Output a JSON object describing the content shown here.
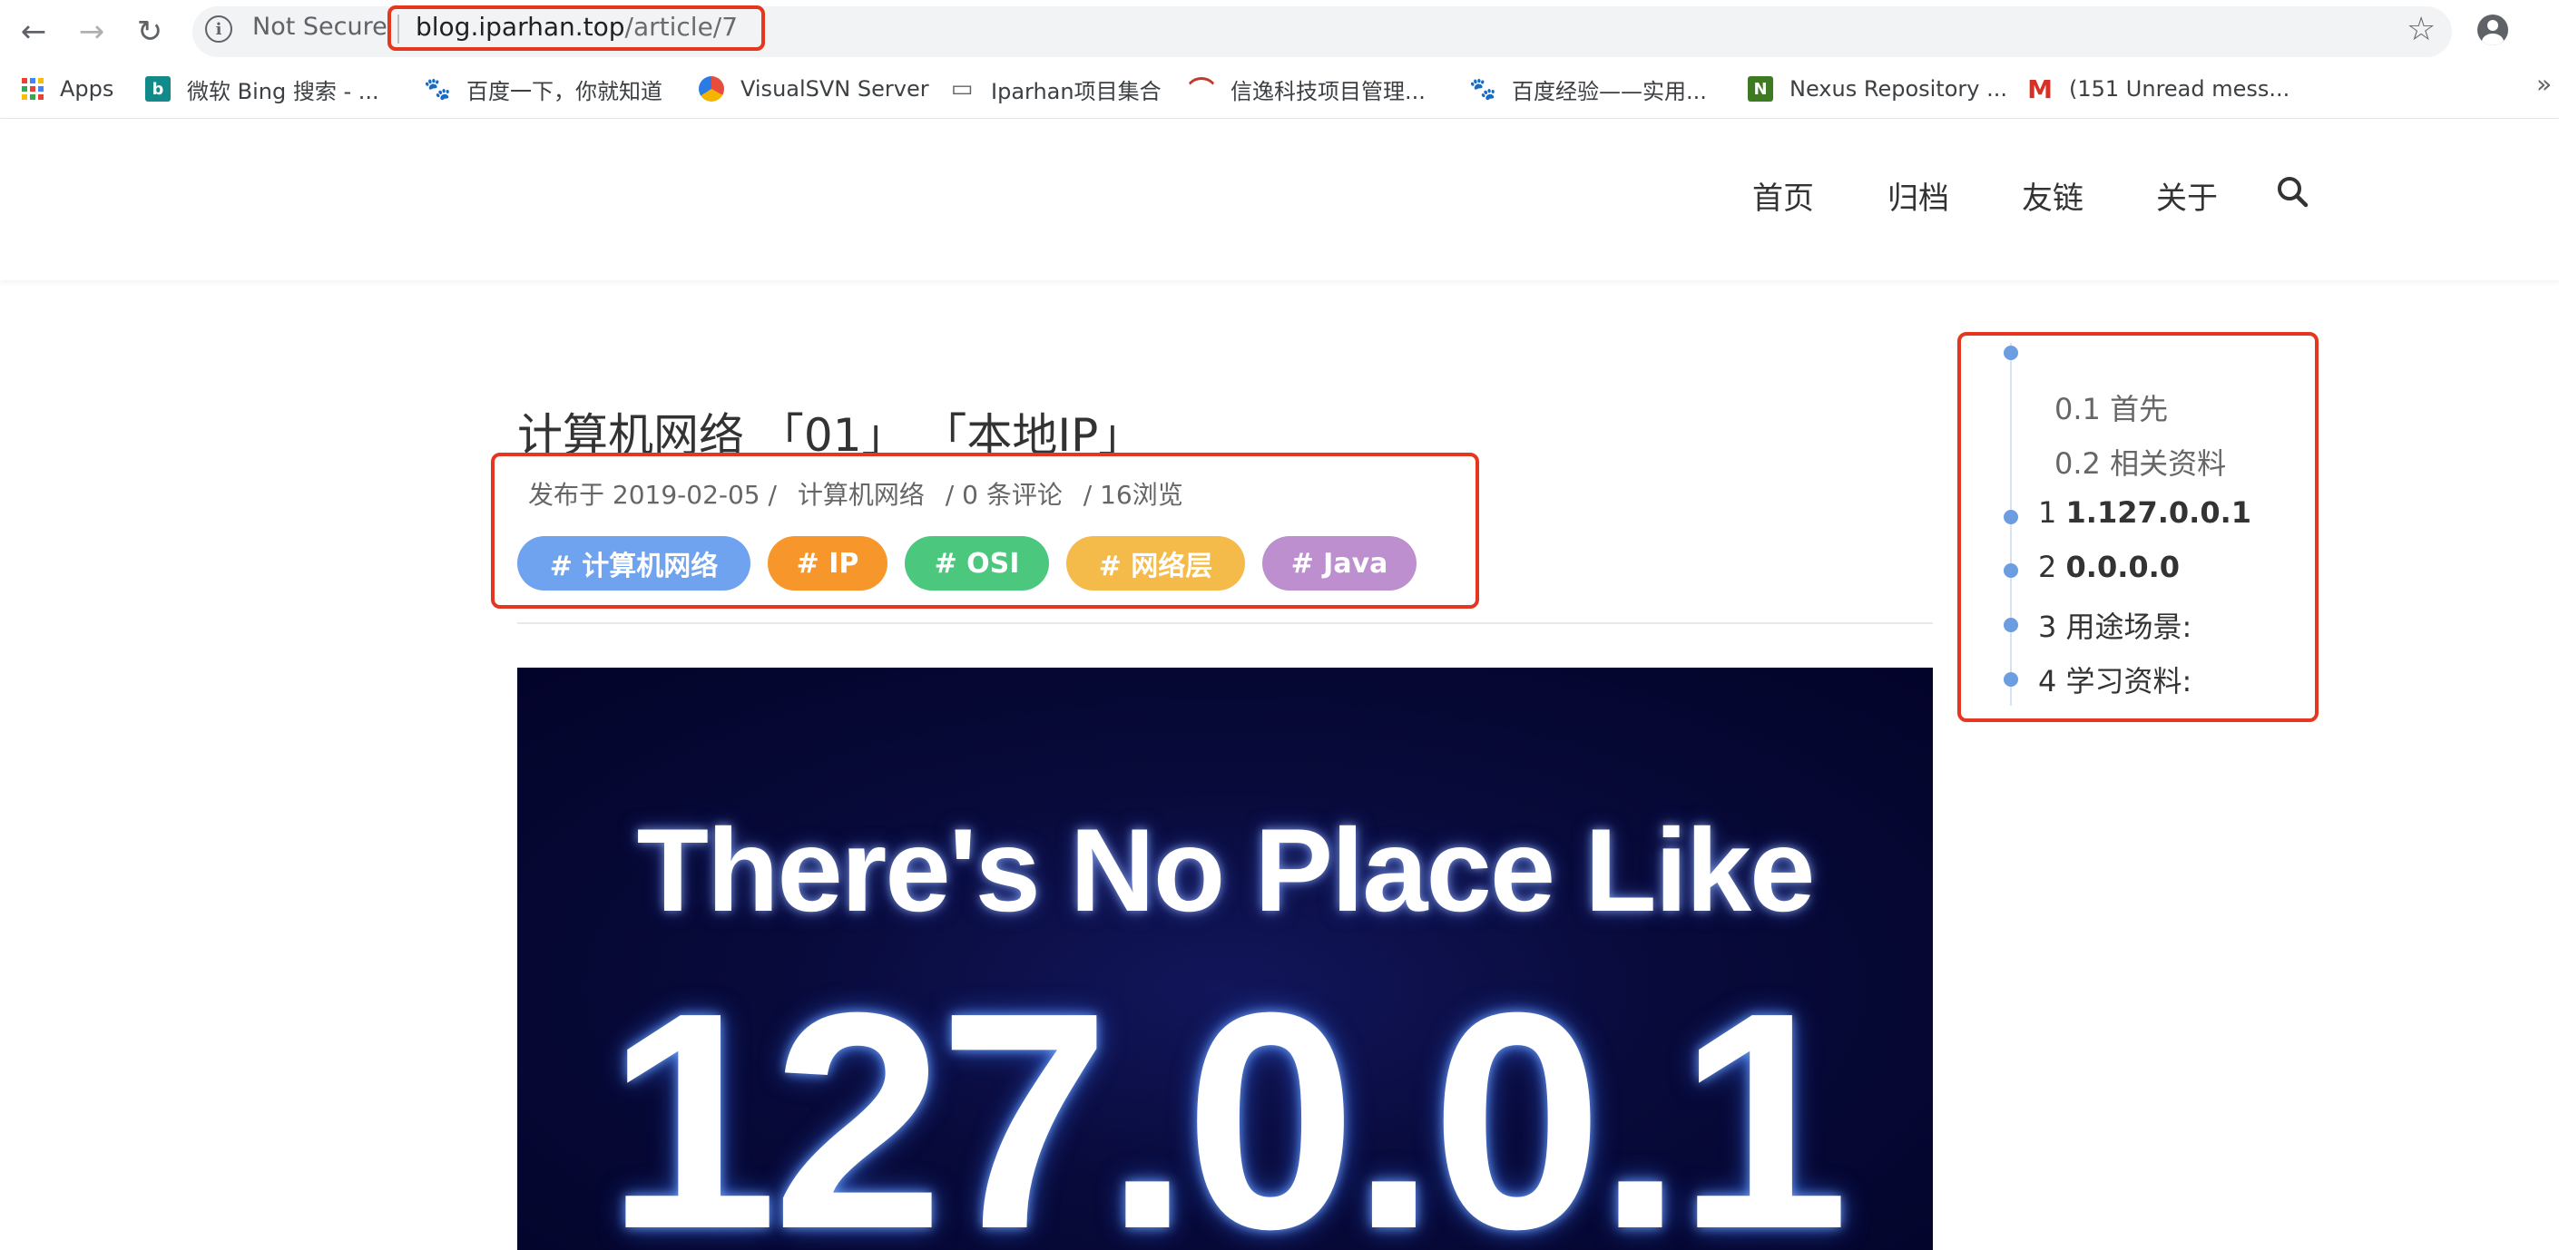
{
  "browser": {
    "url_host": "blog.iparhan.top",
    "url_path": "/article/7",
    "security_label": "Not Secure"
  },
  "bookmarks": [
    {
      "label": "Apps",
      "icon": "apps-grid-icon"
    },
    {
      "label": "微软 Bing 搜索 - ...",
      "icon": "bing-icon"
    },
    {
      "label": "百度一下，你就知道",
      "icon": "baidu-paw-icon"
    },
    {
      "label": "VisualSVN Server",
      "icon": "visualsvn-icon"
    },
    {
      "label": "Iparhan项目集合",
      "icon": "folder-icon"
    },
    {
      "label": "信逸科技项目管理...",
      "icon": "xinyi-icon"
    },
    {
      "label": "百度经验——实用...",
      "icon": "baidu-paw-icon"
    },
    {
      "label": "Nexus Repository ...",
      "icon": "nexus-icon"
    },
    {
      "label": "(151 Unread mess...",
      "icon": "gmail-icon"
    }
  ],
  "site_nav": {
    "items": [
      "首页",
      "归档",
      "友链",
      "关于"
    ]
  },
  "article": {
    "title": "计算机网络 「01」 「本地IP」",
    "published": "发布于 2019-02-05 /",
    "category": "计算机网络",
    "comments": "/ 0 条评论",
    "views": "/ 16浏览",
    "tags": [
      {
        "label": "# 计算机网络",
        "color": "#6fa3ef"
      },
      {
        "label": "# IP",
        "color": "#f7962a"
      },
      {
        "label": "# OSI",
        "color": "#4cc77e"
      },
      {
        "label": "# 网络层",
        "color": "#f4bb4a"
      },
      {
        "label": "# Java",
        "color": "#bd8fcf"
      }
    ],
    "hero_line1": "There's No Place Like",
    "hero_line2": "127.0.0.1"
  },
  "toc": {
    "items": [
      {
        "num": "0.1",
        "text": "首先",
        "level": 2
      },
      {
        "num": "0.2",
        "text": "相关资料",
        "level": 2
      },
      {
        "num": "1",
        "text": "1.127.0.0.1",
        "level": 1,
        "bold": true
      },
      {
        "num": "2",
        "text": "0.0.0.0",
        "level": 1,
        "bold": true
      },
      {
        "num": "3",
        "text": "用途场景:",
        "level": 1
      },
      {
        "num": "4",
        "text": "学习资料:",
        "level": 1
      }
    ]
  },
  "colors": {
    "highlight": "#e5371f",
    "toc_dot": "#6b9de0"
  }
}
